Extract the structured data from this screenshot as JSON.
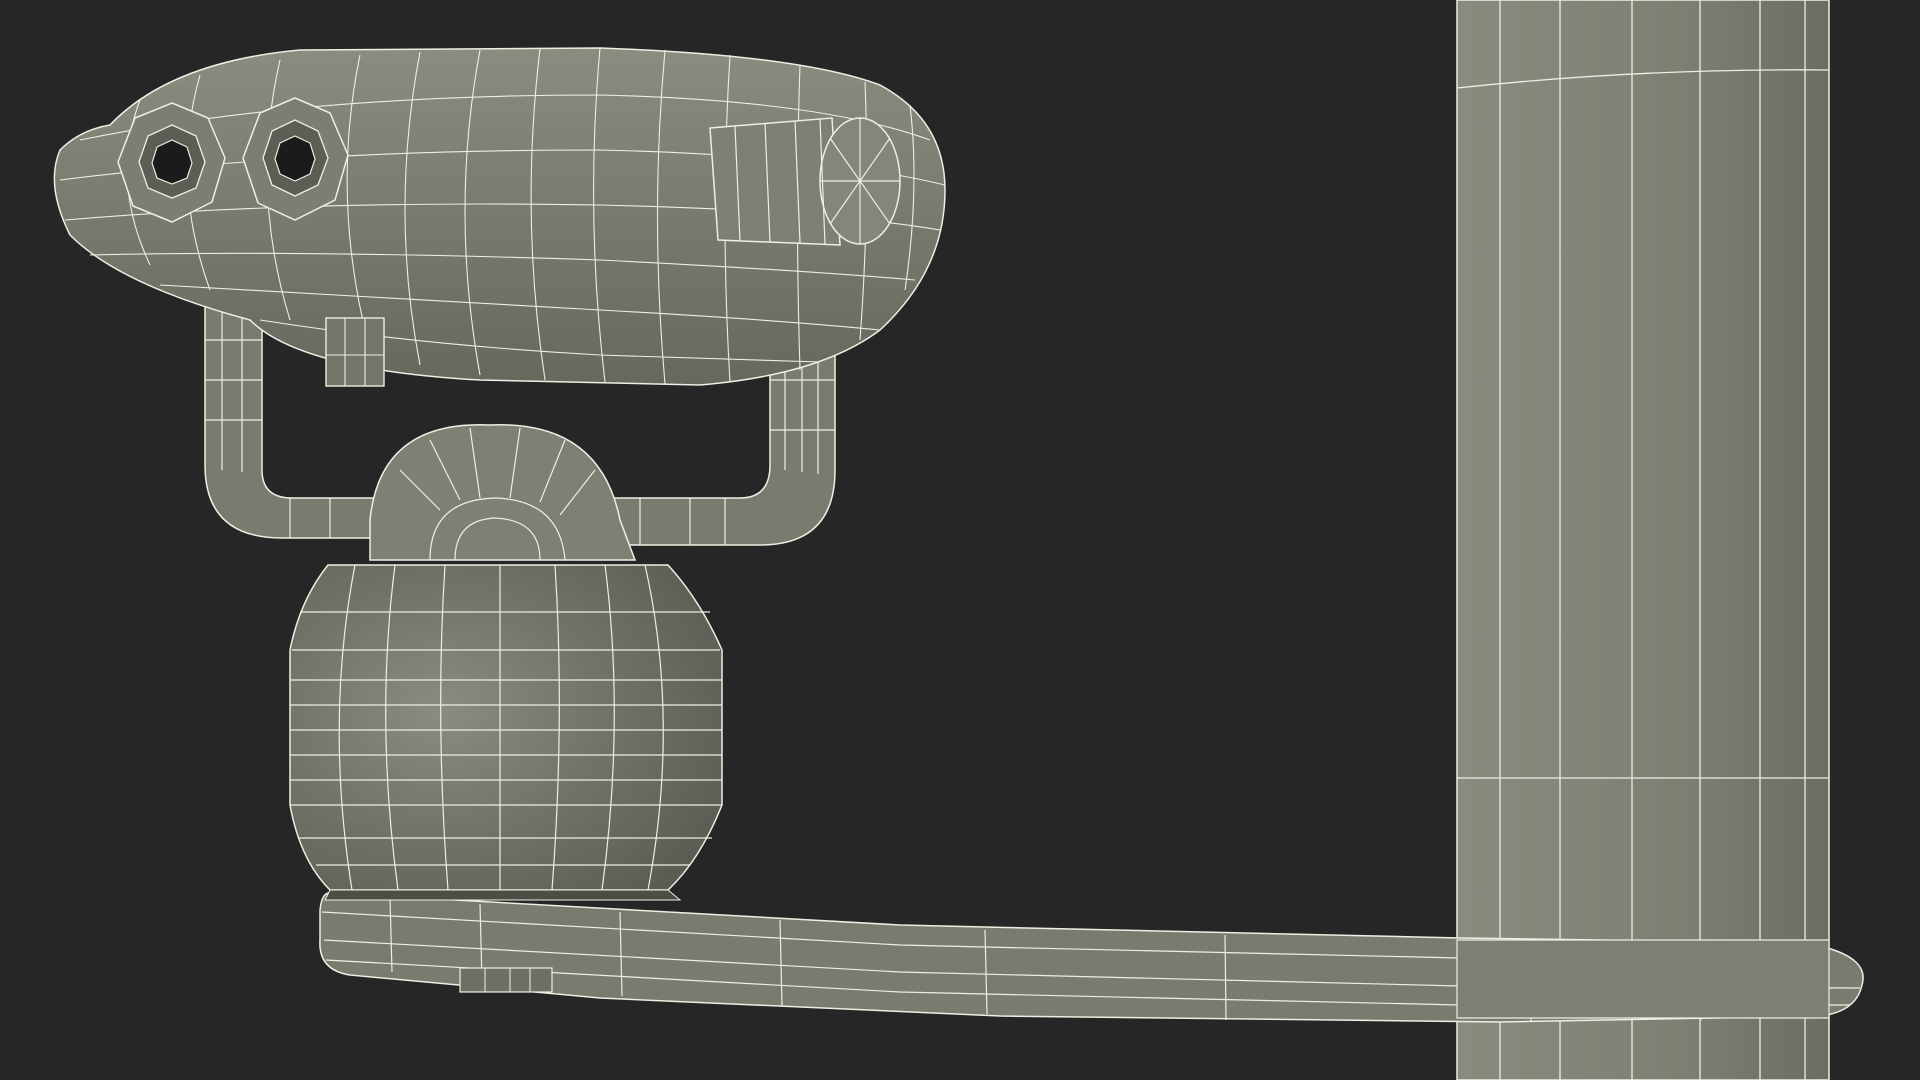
{
  "scene": {
    "subject": "binocular-viewer-wireframe",
    "colors": {
      "background": "#262626",
      "surface": "#7c7d70",
      "surface_light": "#8a8b7e",
      "surface_dark": "#5f6056",
      "wire": "#ecefe2",
      "lens": "#1b1b1b"
    }
  }
}
